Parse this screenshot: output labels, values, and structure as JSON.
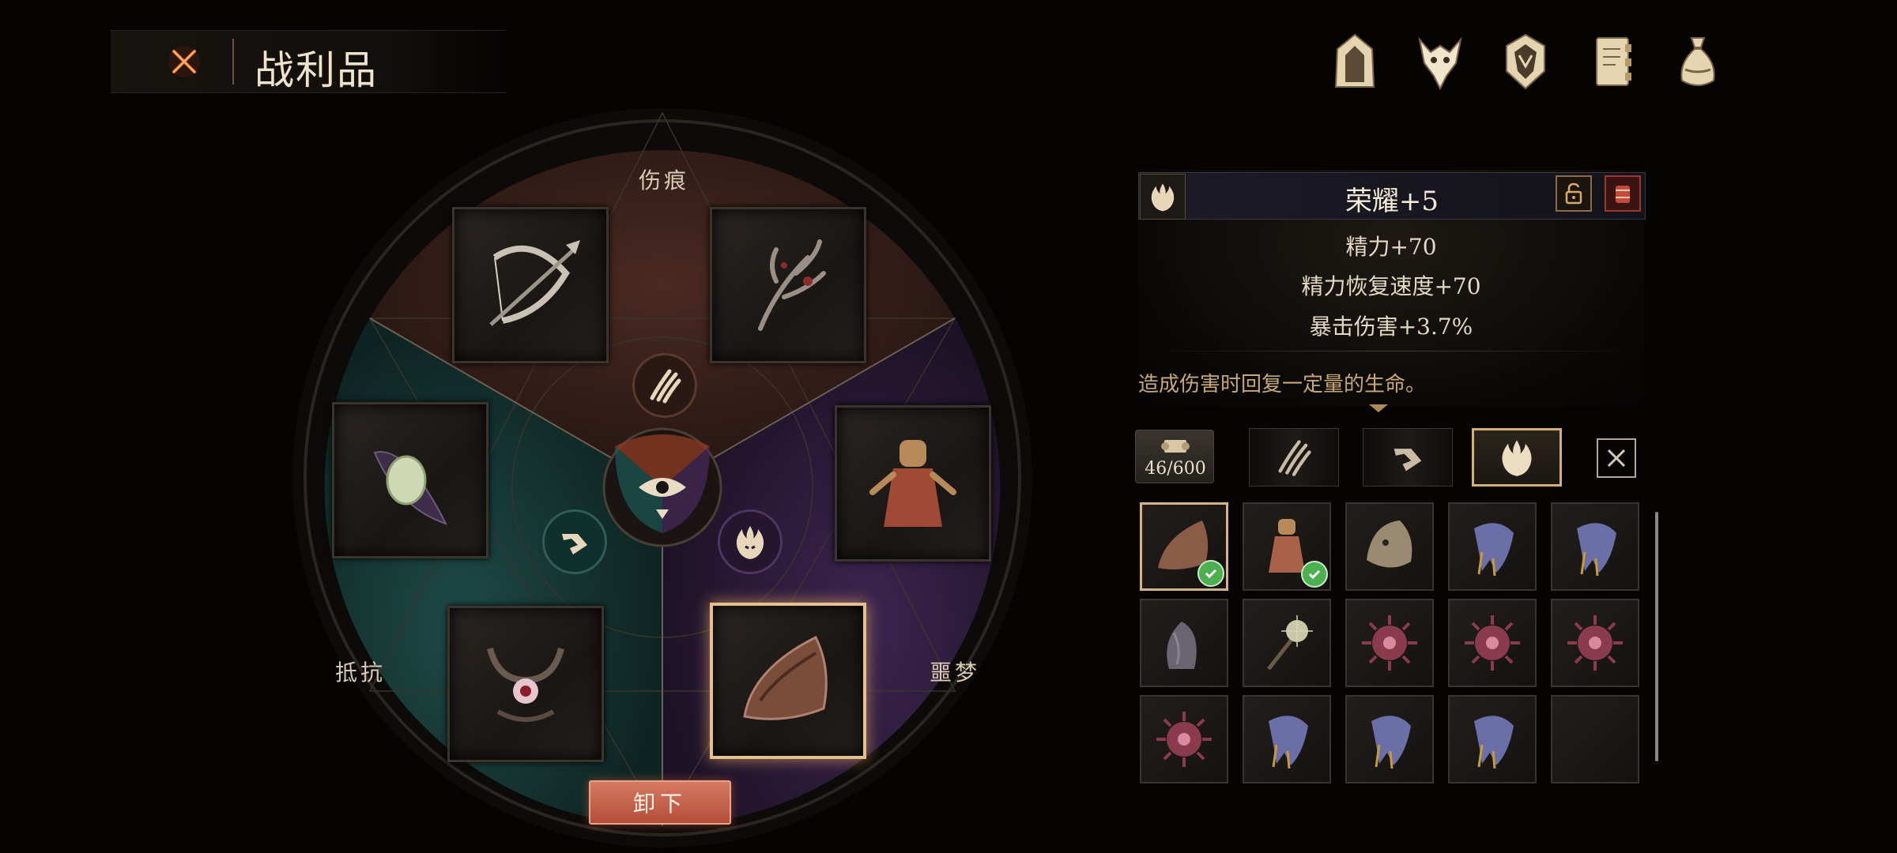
{
  "header": {
    "title": "战利品",
    "close_icon": "crossed-close-icon"
  },
  "top_nav": [
    {
      "name": "hood-icon"
    },
    {
      "name": "beast-skull-icon"
    },
    {
      "name": "crest-shield-icon"
    },
    {
      "name": "journal-icon"
    },
    {
      "name": "loot-bag-icon"
    }
  ],
  "wheel": {
    "labels": {
      "top": "伤痕",
      "left": "抵抗",
      "right": "噩梦"
    },
    "sectors": {
      "top_color": "#3a1f1a",
      "left_color": "#153533",
      "right_color": "#2c1a38"
    },
    "unequip_label": "卸下"
  },
  "detail": {
    "title": "荣耀+5",
    "stats": [
      "精力+70",
      "精力恢复速度+70",
      "暴击伤害+3.7%"
    ],
    "description": "造成伤害时回复一定量的生命。"
  },
  "inventory_meta": {
    "count": "46/600",
    "filters": [
      "claw-marks-icon",
      "chevron-rune-icon",
      "flame-mask-icon"
    ],
    "active_filter": 2
  },
  "inventory": [
    {
      "name": "horn-item",
      "equipped": true,
      "color": "#8a5c47"
    },
    {
      "name": "doll-item",
      "equipped": true,
      "color": "#a8624a"
    },
    {
      "name": "mask-item",
      "equipped": false,
      "color": "#9a8a72"
    },
    {
      "name": "crystal-claw-item",
      "equipped": false,
      "color": "#6b6fa8"
    },
    {
      "name": "crystal-claw-item",
      "equipped": false,
      "color": "#6b6fa8"
    },
    {
      "name": "tentacle-item",
      "equipped": false,
      "color": "#6a6470"
    },
    {
      "name": "pearl-rod-item",
      "equipped": false,
      "color": "#c9c7a7"
    },
    {
      "name": "spiked-orb-item",
      "equipped": false,
      "color": "#8a3b4e"
    },
    {
      "name": "spiked-orb-item",
      "equipped": false,
      "color": "#8a3b4e"
    },
    {
      "name": "spiked-orb-item",
      "equipped": false,
      "color": "#8a3b4e"
    },
    {
      "name": "spiked-orb-item",
      "equipped": false,
      "color": "#8a3b4e"
    },
    {
      "name": "crystal-claw-item",
      "equipped": false,
      "color": "#6b6fa8"
    },
    {
      "name": "crystal-claw-item",
      "equipped": false,
      "color": "#6b6fa8"
    },
    {
      "name": "crystal-claw-item",
      "equipped": false,
      "color": "#6b6fa8"
    },
    {
      "name": "empty-slot",
      "equipped": false,
      "color": ""
    }
  ]
}
